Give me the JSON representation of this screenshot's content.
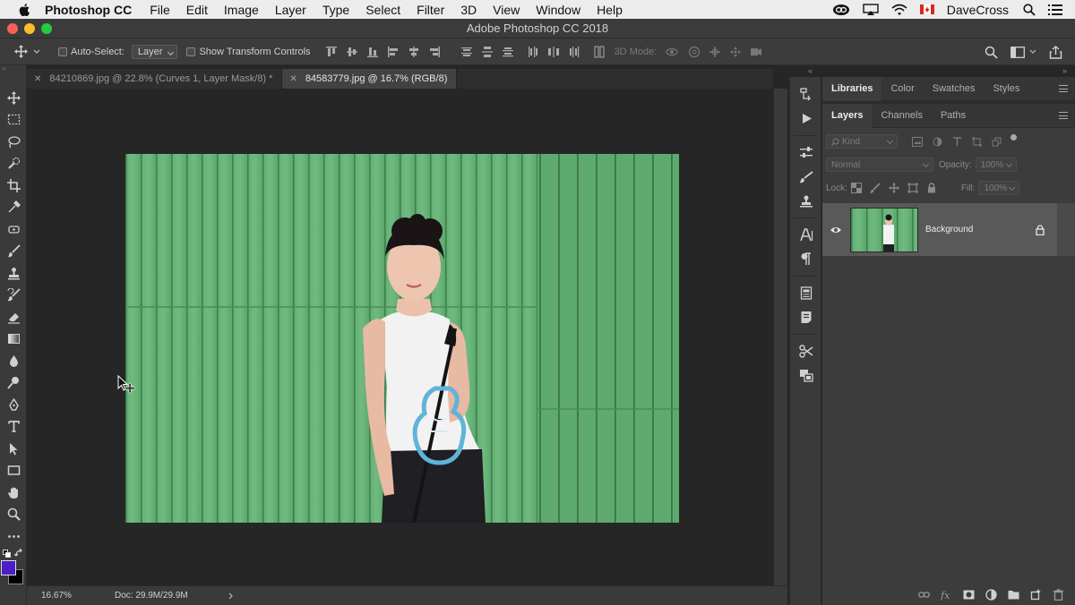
{
  "menubar": {
    "app_name": "Photoshop CC",
    "items": [
      "File",
      "Edit",
      "Image",
      "Layer",
      "Type",
      "Select",
      "Filter",
      "3D",
      "View",
      "Window",
      "Help"
    ],
    "user": "DaveCross"
  },
  "window": {
    "title": "Adobe Photoshop CC 2018"
  },
  "options_bar": {
    "auto_select_label": "Auto-Select:",
    "auto_select_target": "Layer",
    "show_transform_label": "Show Transform Controls",
    "mode_3d_label": "3D Mode:"
  },
  "doc_tabs": [
    {
      "label": "84210869.jpg @ 22.8% (Curves 1, Layer Mask/8) *",
      "active": false
    },
    {
      "label": "84583779.jpg @ 16.7% (RGB/8)",
      "active": true
    }
  ],
  "status_bar": {
    "zoom": "16.67%",
    "doc_size": "Doc: 29.9M/29.9M"
  },
  "panels": {
    "top_tabs": [
      "Libraries",
      "Color",
      "Swatches",
      "Styles"
    ],
    "layer_tabs": [
      "Layers",
      "Channels",
      "Paths"
    ],
    "filter_kind": "Kind",
    "blend_mode": "Normal",
    "opacity_label": "Opacity:",
    "opacity_value": "100%",
    "lock_label": "Lock:",
    "fill_label": "Fill:",
    "fill_value": "100%",
    "layers": [
      {
        "name": "Background",
        "visible": true,
        "locked": true
      }
    ]
  },
  "colors": {
    "foreground": "#4a1ec8",
    "background": "#000000",
    "photo_wall": "#6cb57e"
  }
}
